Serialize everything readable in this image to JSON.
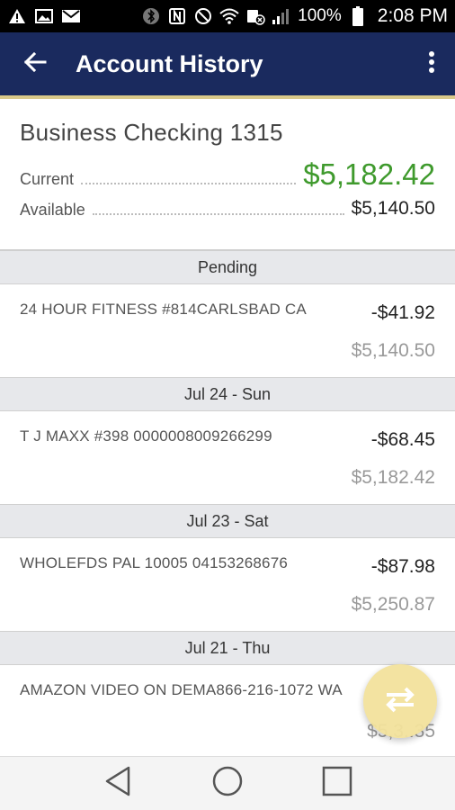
{
  "status_bar": {
    "battery": "100%",
    "time": "2:08 PM"
  },
  "app_bar": {
    "title": "Account History"
  },
  "account": {
    "name": "Business Checking 1315",
    "current_label": "Current",
    "current_value": "$5,182.42",
    "available_label": "Available",
    "available_value": "$5,140.50",
    "current_color": "#3f9a2d"
  },
  "sections": [
    {
      "header": "Pending",
      "transactions": [
        {
          "description": "24 HOUR FITNESS #814CARLSBAD CA",
          "amount": "-$41.92",
          "balance": "$5,140.50"
        }
      ]
    },
    {
      "header": "Jul 24 - Sun",
      "transactions": [
        {
          "description": "T J MAXX #398 0000008009266299",
          "amount": "-$68.45",
          "balance": "$5,182.42"
        }
      ]
    },
    {
      "header": "Jul 23 - Sat",
      "transactions": [
        {
          "description": "WHOLEFDS PAL 10005 04153268676",
          "amount": "-$87.98",
          "balance": "$5,250.87"
        }
      ]
    },
    {
      "header": "Jul 21 - Thu",
      "transactions": [
        {
          "description": "AMAZON VIDEO ON DEMA866-216-1072 WA",
          "amount": "",
          "balance": "$5,3..35"
        }
      ]
    }
  ],
  "colors": {
    "app_bar": "#1a2a5e",
    "accent_gold": "#d9c98a",
    "fab": "#f3e29c"
  },
  "icons": {
    "back": "arrow-left-icon",
    "more": "more-vertical-icon",
    "fab": "transfer-arrows-icon",
    "nav": [
      "back-triangle-icon",
      "home-circle-icon",
      "recents-square-icon"
    ]
  }
}
